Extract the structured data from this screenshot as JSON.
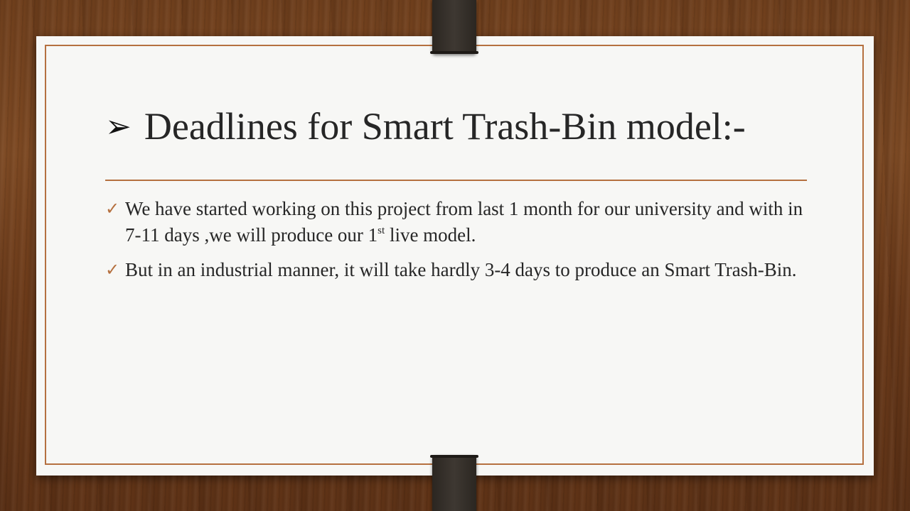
{
  "slide": {
    "title": "Deadlines for Smart Trash-Bin model:-",
    "title_icon": "arrowhead-bullet-icon",
    "bullet_icon": "checkmark-icon",
    "accent_color": "#b5703f",
    "bullets": [
      {
        "text_before_sup": "We have started working on this project from last 1 month for our university and with in 7-11 days ,we will produce our 1",
        "sup": "st",
        "text_after_sup": " live model."
      },
      {
        "text_before_sup": "But in an industrial manner, it will take hardly 3-4 days to produce an Smart Trash-Bin.",
        "sup": "",
        "text_after_sup": ""
      }
    ]
  }
}
